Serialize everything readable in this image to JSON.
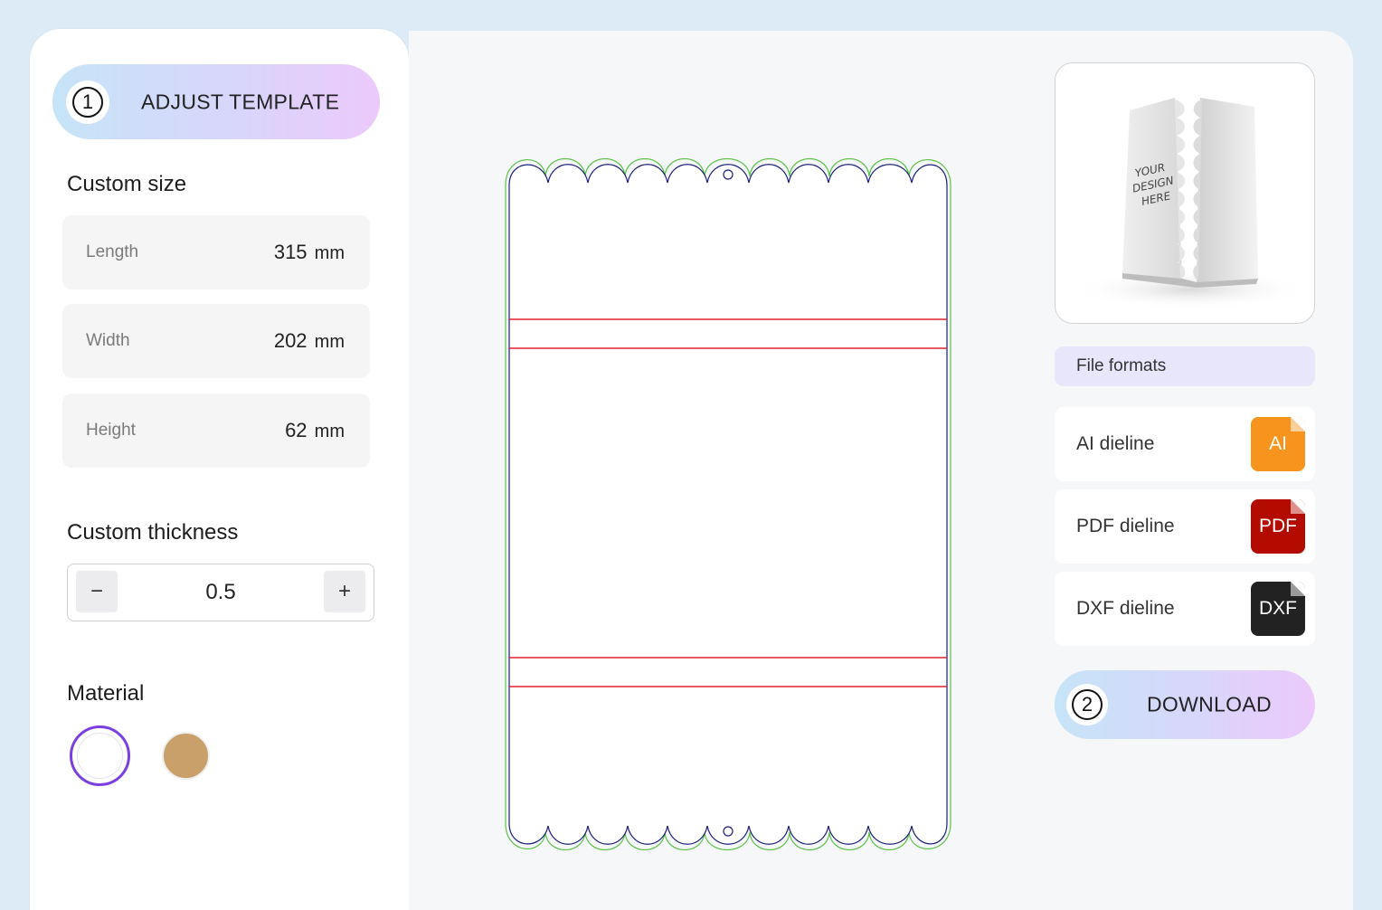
{
  "sidebar": {
    "step1": {
      "number": "1",
      "label": "ADJUST TEMPLATE"
    },
    "custom_size": {
      "title": "Custom size",
      "fields": [
        {
          "label": "Length",
          "value": "315",
          "unit": "mm"
        },
        {
          "label": "Width",
          "value": "202",
          "unit": "mm"
        },
        {
          "label": "Height",
          "value": "62",
          "unit": "mm"
        }
      ]
    },
    "custom_thickness": {
      "title": "Custom thickness",
      "value": "0.5",
      "decrement": "−",
      "increment": "+"
    },
    "material": {
      "title": "Material",
      "options": [
        {
          "name": "white",
          "color": "#ffffff",
          "selected": true
        },
        {
          "name": "kraft",
          "color": "#c9a06a",
          "selected": false
        }
      ],
      "selected_ring_color": "#7b3fe0"
    }
  },
  "preview": {
    "mockup_text": [
      "YOUR",
      "DESIGN",
      "HERE"
    ]
  },
  "file_formats": {
    "title": "File formats",
    "items": [
      {
        "label": "AI dieline",
        "icon_text": "AI",
        "color": "#f7941d"
      },
      {
        "label": "PDF dieline",
        "icon_text": "PDF",
        "color": "#b30b00"
      },
      {
        "label": "DXF dieline",
        "icon_text": "DXF",
        "color": "#222222"
      }
    ]
  },
  "step2": {
    "number": "2",
    "label": "DOWNLOAD"
  },
  "dieline_colors": {
    "cut": "#1b1f7a",
    "bleed": "#5cc24a",
    "fold": "#e0202a"
  }
}
